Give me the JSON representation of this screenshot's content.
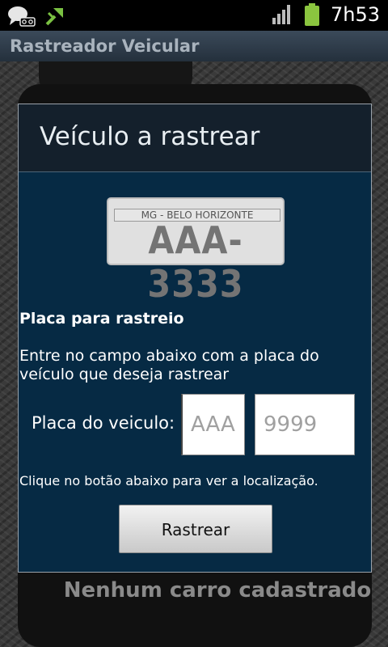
{
  "status_bar": {
    "time": "7h53",
    "icons": [
      "voicemail-icon",
      "usb-debug-icon",
      "signal-icon",
      "battery-icon"
    ]
  },
  "app": {
    "title": "Rastreador Veicular"
  },
  "background": {
    "empty_message": "Nenhum carro cadastrado"
  },
  "dialog": {
    "title": "Veículo a rastrear",
    "plate_image": {
      "city": "MG - BELO HORIZONTE",
      "number": "AAA-3333"
    },
    "section_title": "Placa para rastreio",
    "instructions": "Entre no campo abaixo com a placa do veículo que deseja rastrear",
    "field_label": "Placa do veiculo:",
    "letters_input": {
      "value": "",
      "placeholder": "AAA"
    },
    "numbers_input": {
      "value": "",
      "placeholder": "9999"
    },
    "hint": "Clique no botão abaixo para ver a localização.",
    "button_label": "Rastrear"
  },
  "colors": {
    "dialog_bg": "#062a44",
    "header_bg": "#14202c",
    "battery": "#8bc53f",
    "usb_icon": "#7ac142"
  }
}
